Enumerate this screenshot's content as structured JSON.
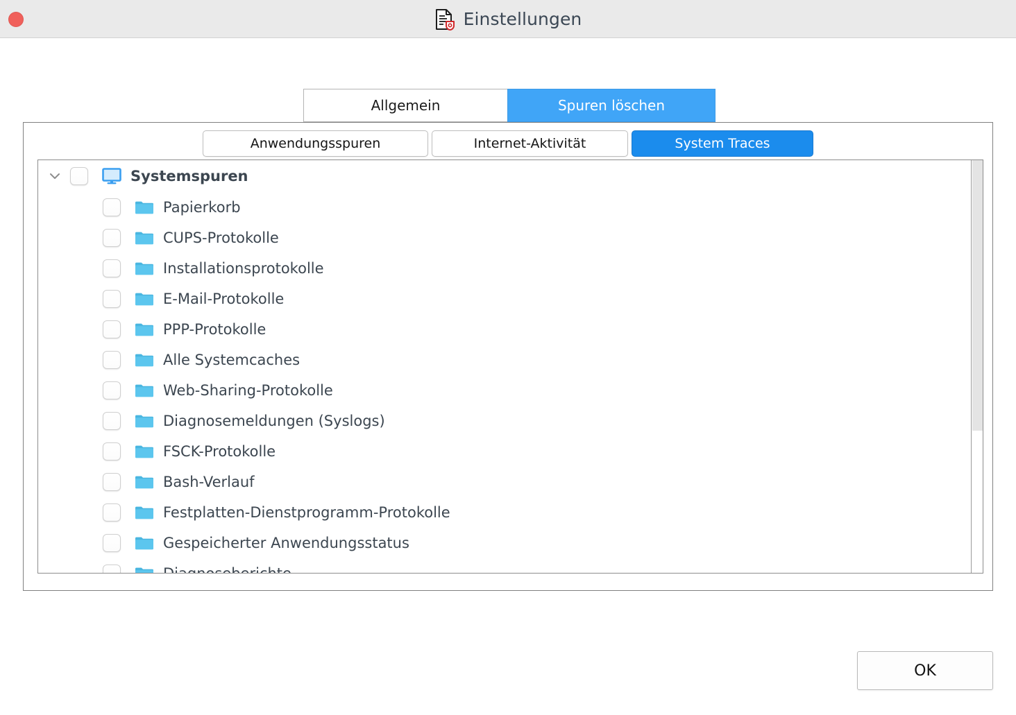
{
  "window": {
    "title": "Einstellungen",
    "title_icon": "document-shield-icon",
    "close_button": "close-window-button"
  },
  "top_tabs": [
    {
      "label": "Allgemein",
      "active": false
    },
    {
      "label": "Spuren löschen",
      "active": true
    }
  ],
  "inner_tabs": [
    {
      "label": "Anwendungsspuren",
      "active": false
    },
    {
      "label": "Internet-Aktivität",
      "active": false
    },
    {
      "label": "System Traces",
      "active": true
    }
  ],
  "tree": {
    "root": {
      "label": "Systemspuren",
      "icon": "monitor-icon",
      "expanded": true,
      "checked": false
    },
    "items": [
      {
        "label": "Papierkorb",
        "icon": "folder-icon",
        "checked": false
      },
      {
        "label": "CUPS-Protokolle",
        "icon": "folder-icon",
        "checked": false
      },
      {
        "label": "Installationsprotokolle",
        "icon": "folder-icon",
        "checked": false
      },
      {
        "label": "E-Mail-Protokolle",
        "icon": "folder-icon",
        "checked": false
      },
      {
        "label": "PPP-Protokolle",
        "icon": "folder-icon",
        "checked": false
      },
      {
        "label": "Alle Systemcaches",
        "icon": "folder-icon",
        "checked": false
      },
      {
        "label": "Web-Sharing-Protokolle",
        "icon": "folder-icon",
        "checked": false
      },
      {
        "label": "Diagnosemeldungen (Syslogs)",
        "icon": "folder-icon",
        "checked": false
      },
      {
        "label": "FSCK-Protokolle",
        "icon": "folder-icon",
        "checked": false
      },
      {
        "label": "Bash-Verlauf",
        "icon": "folder-icon",
        "checked": false
      },
      {
        "label": "Festplatten-Dienstprogramm-Protokolle",
        "icon": "folder-icon",
        "checked": false
      },
      {
        "label": "Gespeicherter Anwendungsstatus",
        "icon": "folder-icon",
        "checked": false
      },
      {
        "label": "Diagnoseberichte",
        "icon": "folder-icon",
        "checked": false
      }
    ]
  },
  "buttons": {
    "ok_label": "OK"
  },
  "colors": {
    "titlebar_bg": "#eaeaea",
    "close_button": "#f0605b",
    "top_tab_active": "#40a5f7",
    "inner_tab_active": "#1b8ced",
    "folder_icon": "#5cc6ee",
    "monitor_icon": "#3b9ff0",
    "text": "#3c4650",
    "border": "#808080",
    "scrollbar_thumb": "#e4e4e4"
  }
}
